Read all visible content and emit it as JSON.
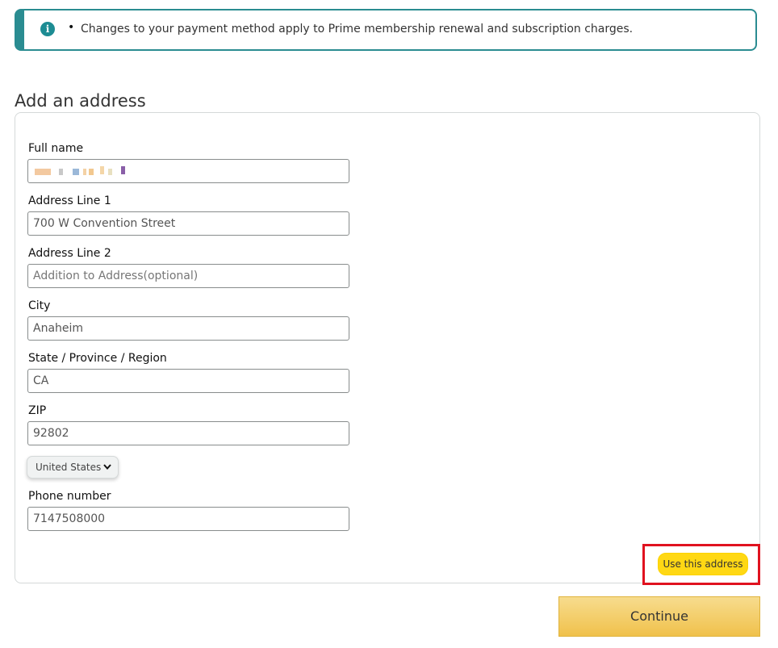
{
  "notice": {
    "icon": "info-icon",
    "text": "Changes to your payment method apply to Prime membership renewal and subscription charges."
  },
  "section_title": "Add an address",
  "form": {
    "full_name": {
      "label": "Full name",
      "value": ""
    },
    "address_line_1": {
      "label": "Address Line 1",
      "value": "700 W Convention Street"
    },
    "address_line_2": {
      "label": "Address Line 2",
      "placeholder": "Addition to Address(optional)"
    },
    "city": {
      "label": "City",
      "value": "Anaheim"
    },
    "state": {
      "label": "State / Province / Region",
      "value": "CA"
    },
    "zip": {
      "label": "ZIP",
      "value": "92802"
    },
    "country": {
      "selected": "United States",
      "icon": "chevron-down-icon"
    },
    "phone": {
      "label": "Phone number",
      "value": "7147508000"
    }
  },
  "buttons": {
    "use_address": "Use this address",
    "continue": "Continue"
  },
  "colors": {
    "notice_border": "#2a8c91",
    "primary_button": "#ffd814",
    "continue_button": "#f0c14b",
    "highlight": "#e0121f"
  }
}
